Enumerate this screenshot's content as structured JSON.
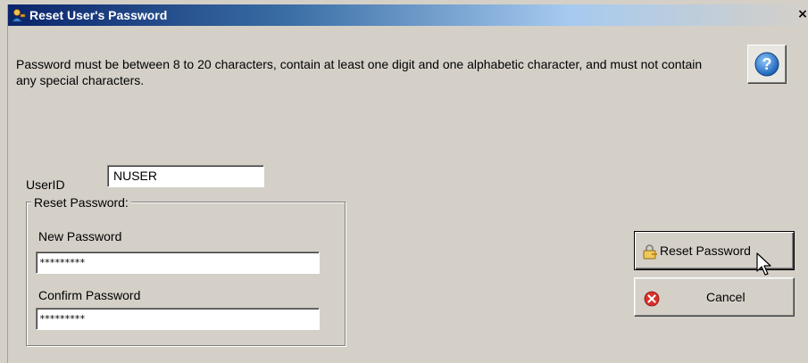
{
  "window": {
    "title": "Reset User's Password",
    "close_symbol": "×",
    "title_icon": "user-key-icon"
  },
  "instructions": "Password must be between 8 to 20 characters, contain at least one digit and one alphabetic character, and must not contain any special characters.",
  "help": {
    "icon": "help-question-icon",
    "symbol": "?"
  },
  "userid": {
    "label": "UserID",
    "value": "NUSER"
  },
  "reset_group": {
    "legend": "Reset Password:",
    "new_password_label": "New Password",
    "new_password_value": "*********",
    "confirm_password_label": "Confirm Password",
    "confirm_password_value": "*********"
  },
  "buttons": {
    "reset_label": "Reset Password",
    "reset_icon": "key-lock-icon",
    "cancel_label": "Cancel",
    "cancel_icon": "red-x-circle-icon"
  },
  "colors": {
    "title_bar_start": "#0a246a",
    "title_bar_end": "#a6caf0",
    "dialog_bg": "#d4d0c8",
    "help_blue": "#1e73c8",
    "cancel_red": "#d9302b"
  }
}
